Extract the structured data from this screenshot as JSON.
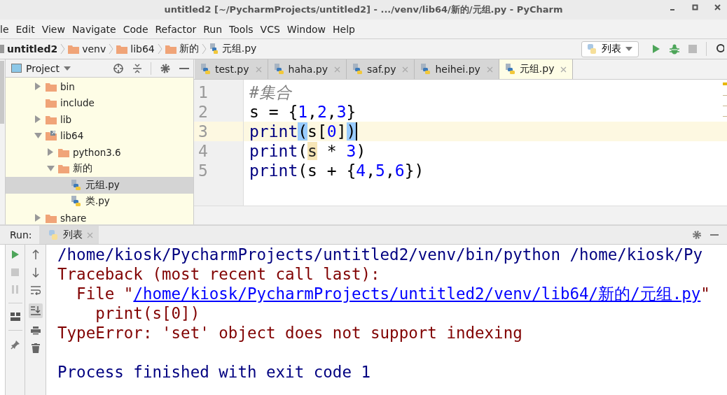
{
  "window": {
    "title": "untitled2 [~/PycharmProjects/untitled2] - .../venv/lib64/新的/元组.py - PyCharm"
  },
  "menu": [
    "le",
    "Edit",
    "View",
    "Navigate",
    "Code",
    "Refactor",
    "Run",
    "Tools",
    "VCS",
    "Window",
    "Help"
  ],
  "breadcrumbs": [
    {
      "label": "untitled2",
      "kind": "project"
    },
    {
      "label": "venv",
      "kind": "folder"
    },
    {
      "label": "lib64",
      "kind": "folder"
    },
    {
      "label": "新的",
      "kind": "folder"
    },
    {
      "label": "元组.py",
      "kind": "file"
    }
  ],
  "run_config": {
    "label": "列表"
  },
  "project_panel": {
    "title": "Project",
    "tree": [
      {
        "label": "bin",
        "kind": "folder",
        "expanded": false,
        "selected": false
      },
      {
        "label": "include",
        "kind": "folder",
        "selected": false
      },
      {
        "label": "lib",
        "kind": "folder",
        "expanded": false,
        "selected": false
      },
      {
        "label": "lib64",
        "kind": "folder-link",
        "expanded": true,
        "selected": false,
        "children": [
          {
            "label": "python3.6",
            "kind": "folder",
            "expanded": false,
            "selected": false
          },
          {
            "label": "新的",
            "kind": "folder",
            "expanded": true,
            "selected": false,
            "children": [
              {
                "label": "元组.py",
                "kind": "file",
                "selected": true
              },
              {
                "label": "类.py",
                "kind": "file",
                "selected": false
              }
            ]
          }
        ]
      },
      {
        "label": "share",
        "kind": "folder",
        "expanded": false,
        "selected": false
      }
    ]
  },
  "editor": {
    "tabs": [
      {
        "label": "test.py",
        "selected": false
      },
      {
        "label": "haha.py",
        "selected": false
      },
      {
        "label": "saf.py",
        "selected": false
      },
      {
        "label": "heihei.py",
        "selected": false
      },
      {
        "label": "元组.py",
        "selected": true
      }
    ],
    "lines": [
      {
        "number": "1",
        "current": false,
        "caret": false,
        "tokens": [
          {
            "kind": "comment",
            "text": "#集合"
          }
        ]
      },
      {
        "number": "2",
        "current": false,
        "caret": false,
        "tokens": [
          {
            "kind": "plain",
            "text": "s = {"
          },
          {
            "kind": "number",
            "text": "1"
          },
          {
            "kind": "plain",
            "text": ","
          },
          {
            "kind": "number",
            "text": "2"
          },
          {
            "kind": "plain",
            "text": ","
          },
          {
            "kind": "number",
            "text": "3"
          },
          {
            "kind": "plain",
            "text": "}"
          }
        ]
      },
      {
        "number": "3",
        "current": true,
        "caret": true,
        "tokens": [
          {
            "kind": "builtin",
            "text": "print"
          },
          {
            "kind": "match",
            "text": "("
          },
          {
            "kind": "plain",
            "text": "s["
          },
          {
            "kind": "number",
            "text": "0"
          },
          {
            "kind": "plain",
            "text": "]"
          },
          {
            "kind": "match",
            "text": ")"
          }
        ]
      },
      {
        "number": "4",
        "current": false,
        "caret": false,
        "tokens": [
          {
            "kind": "builtin",
            "text": "print"
          },
          {
            "kind": "plain",
            "text": "("
          },
          {
            "kind": "usage",
            "text": "s"
          },
          {
            "kind": "plain",
            "text": " * "
          },
          {
            "kind": "number",
            "text": "3"
          },
          {
            "kind": "plain",
            "text": ")"
          }
        ]
      },
      {
        "number": "5",
        "current": false,
        "caret": false,
        "tokens": [
          {
            "kind": "builtin",
            "text": "print"
          },
          {
            "kind": "plain",
            "text": "(s + {"
          },
          {
            "kind": "number",
            "text": "4"
          },
          {
            "kind": "plain",
            "text": ","
          },
          {
            "kind": "number",
            "text": "5"
          },
          {
            "kind": "plain",
            "text": ","
          },
          {
            "kind": "number",
            "text": "6"
          },
          {
            "kind": "plain",
            "text": "})"
          }
        ]
      }
    ]
  },
  "run_panel": {
    "label": "Run:",
    "tab": {
      "label": "列表"
    },
    "console": [
      {
        "gap_before": false,
        "segments": [
          {
            "kind": "command",
            "text": "/home/kiosk/PycharmProjects/untitled2/venv/bin/python /home/kiosk/Py"
          }
        ]
      },
      {
        "gap_before": false,
        "segments": [
          {
            "kind": "error",
            "text": "Traceback (most recent call last):"
          }
        ]
      },
      {
        "gap_before": false,
        "segments": [
          {
            "kind": "error",
            "text": "  File \""
          },
          {
            "kind": "link",
            "text": "/home/kiosk/PycharmProjects/untitled2/venv/lib64/新的/元组.py"
          },
          {
            "kind": "error",
            "text": "\""
          }
        ]
      },
      {
        "gap_before": false,
        "segments": [
          {
            "kind": "error",
            "text": "    print(s[0])"
          }
        ]
      },
      {
        "gap_before": false,
        "segments": [
          {
            "kind": "error",
            "text": "TypeError: 'set' object does not support indexing"
          }
        ]
      },
      {
        "gap_before": true,
        "segments": [
          {
            "kind": "command",
            "text": "Process finished with exit code 1"
          }
        ]
      }
    ]
  }
}
